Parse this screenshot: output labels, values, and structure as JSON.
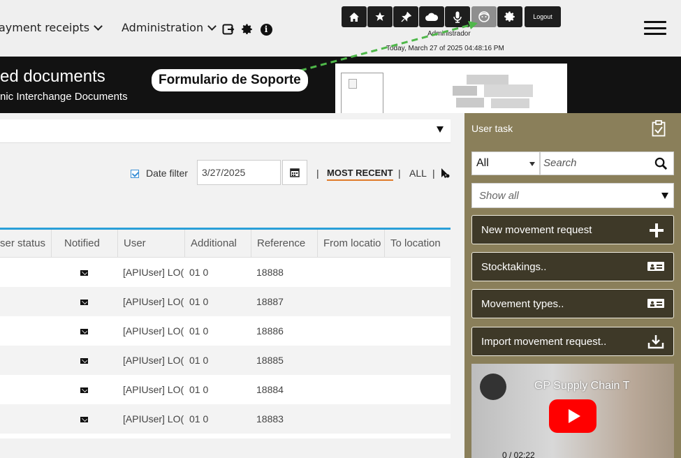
{
  "nav": {
    "payment_receipts": "ayment receipts",
    "administration": "Administration"
  },
  "toolbar": {
    "logout": "Logout",
    "user": "Administrador",
    "datetime": "Today, March 27 of 2025 04:48:16 PM"
  },
  "banner": {
    "title": "ed documents",
    "subtitle": "nic Interchange Documents",
    "tooltip": "Formulario de Soporte"
  },
  "filters": {
    "date_filter_label": "Date filter",
    "date_value": "3/27/2025",
    "most_recent": "MOST RECENT",
    "all": "ALL",
    "separator": "|"
  },
  "grid": {
    "columns": [
      "ser status",
      "Notified",
      "User",
      "Additional",
      "Reference",
      "From locatio",
      "To location"
    ],
    "rows": [
      {
        "user": "[APIUser] LO(",
        "additional": "01 0",
        "reference": "18888"
      },
      {
        "user": "[APIUser] LO(",
        "additional": "01 0",
        "reference": "18887"
      },
      {
        "user": "[APIUser] LO(",
        "additional": "01 0",
        "reference": "18886"
      },
      {
        "user": "[APIUser] LO(",
        "additional": "01 0",
        "reference": "18885"
      },
      {
        "user": "[APIUser] LO(",
        "additional": "01 0",
        "reference": "18884"
      },
      {
        "user": "[APIUser] LO(",
        "additional": "01 0",
        "reference": "18883"
      }
    ]
  },
  "sidebar": {
    "title": "User task",
    "scope": "All",
    "search_placeholder": "Search",
    "show_all": "Show all",
    "buttons": {
      "new_movement": "New movement request",
      "stocktakings": "Stocktakings..",
      "movement_types": "Movement types..",
      "import_movement": "Import movement request.."
    },
    "video": {
      "title": "GP Supply Chain T",
      "time": "0 / 02:22"
    }
  },
  "colors": {
    "sidebar_bg": "#8a7f5a",
    "sidebar_button": "#3e3928",
    "accent_orange": "#e07b2a",
    "grid_accent": "#2a9fd8",
    "arrow_green": "#4fb84a"
  }
}
